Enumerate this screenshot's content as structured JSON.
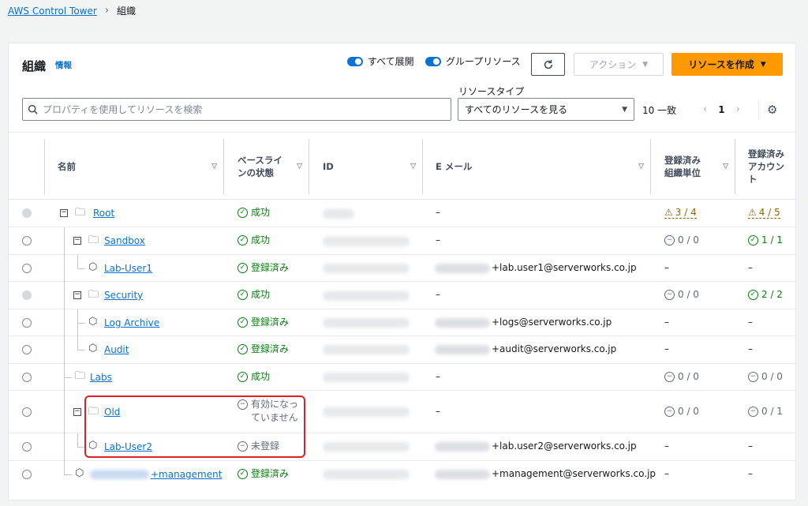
{
  "breadcrumb": {
    "root": "AWS Control Tower",
    "current": "組織"
  },
  "header": {
    "title": "組織",
    "info": "情報",
    "toggle_expand": "すべて展開",
    "toggle_group": "グループリソース",
    "action_label": "アクション",
    "create_label": "リソースを作成"
  },
  "filter": {
    "search_placeholder": "プロパティを使用してリソースを検索",
    "type_label": "リソースタイプ",
    "type_value": "すべてのリソースを見る",
    "match": "10 一致",
    "page": "1"
  },
  "columns": {
    "name": "名前",
    "baseline": "ベースラインの状態",
    "id": "ID",
    "email": "E メール",
    "registered_ou": "登録済み組織単位",
    "registered_acct": "登録済みアカウント"
  },
  "rows": [
    {
      "name": "Root",
      "status": "成功",
      "email": "–",
      "ou": "3 / 4",
      "acct": "4 / 5"
    },
    {
      "name": "Sandbox",
      "status": "成功",
      "email": "–",
      "ou": "0 / 0",
      "acct": "1 / 1"
    },
    {
      "name": "Lab-User1",
      "status": "登録済み",
      "email": "+lab.user1@serverworks.co.jp",
      "ou": "–",
      "acct": "–"
    },
    {
      "name": "Security",
      "status": "成功",
      "email": "–",
      "ou": "0 / 0",
      "acct": "2 / 2"
    },
    {
      "name": "Log Archive",
      "status": "登録済み",
      "email": "+logs@serverworks.co.jp",
      "ou": "–",
      "acct": "–"
    },
    {
      "name": "Audit",
      "status": "登録済み",
      "email": "+audit@serverworks.co.jp",
      "ou": "–",
      "acct": "–"
    },
    {
      "name": "Labs",
      "status": "成功",
      "email": "–",
      "ou": "0 / 0",
      "acct": "0 / 0"
    },
    {
      "name": "Old",
      "status": "有効になっていません",
      "email": "–",
      "ou": "0 / 0",
      "acct": "0 / 1"
    },
    {
      "name": "Lab-User2",
      "status": "未登録",
      "email": "+lab.user2@serverworks.co.jp",
      "ou": "–",
      "acct": "–"
    },
    {
      "name": "+management",
      "status": "登録済み",
      "email": "+management@serverworks.co.jp",
      "ou": "–",
      "acct": "–"
    }
  ],
  "colors": {
    "accent": "#0972d3",
    "primary_button": "#ff9900",
    "success": "#037f0c",
    "warning": "#8d6605",
    "highlight": "#e02020"
  }
}
